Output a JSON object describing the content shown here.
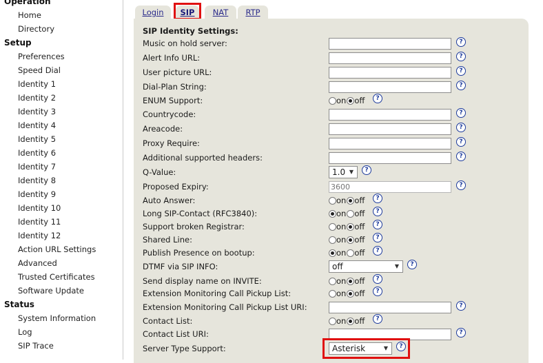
{
  "sidebar": {
    "sections": [
      {
        "title": "Operation",
        "items": [
          "Home",
          "Directory"
        ]
      },
      {
        "title": "Setup",
        "items": [
          "Preferences",
          "Speed Dial",
          "Identity 1",
          "Identity 2",
          "Identity 3",
          "Identity 4",
          "Identity 5",
          "Identity 6",
          "Identity 7",
          "Identity 8",
          "Identity 9",
          "Identity 10",
          "Identity 11",
          "Identity 12",
          "Action URL Settings",
          "Advanced",
          "Trusted Certificates",
          "Software Update"
        ]
      },
      {
        "title": "Status",
        "items": [
          "System Information",
          "Log",
          "SIP Trace"
        ]
      }
    ]
  },
  "tabs": [
    {
      "label": "Login",
      "active": false
    },
    {
      "label": "SIP",
      "active": true
    },
    {
      "label": "NAT",
      "active": false
    },
    {
      "label": "RTP",
      "active": false
    }
  ],
  "section_title": "SIP Identity Settings:",
  "help_glyph": "?",
  "radio_labels": {
    "on": "on",
    "off": "off"
  },
  "fields": [
    {
      "label": "Music on hold server:",
      "type": "text",
      "value": ""
    },
    {
      "label": "Alert Info URL:",
      "type": "text",
      "value": ""
    },
    {
      "label": "User picture URL:",
      "type": "text",
      "value": ""
    },
    {
      "label": "Dial-Plan String:",
      "type": "text",
      "value": ""
    },
    {
      "label": "ENUM Support:",
      "type": "radio",
      "value": "off"
    },
    {
      "label": "Countrycode:",
      "type": "text",
      "value": ""
    },
    {
      "label": "Areacode:",
      "type": "text",
      "value": ""
    },
    {
      "label": "Proxy Require:",
      "type": "text",
      "value": ""
    },
    {
      "label": "Additional supported headers:",
      "type": "text",
      "value": ""
    },
    {
      "label": "Q-Value:",
      "type": "select",
      "value": "1.0"
    },
    {
      "label": "Proposed Expiry:",
      "type": "text",
      "value": "",
      "placeholder": "3600",
      "disabled": true
    },
    {
      "label": "Auto Answer:",
      "type": "radio",
      "value": "off"
    },
    {
      "label": "Long SIP-Contact (RFC3840):",
      "type": "radio",
      "value": "on"
    },
    {
      "label": "Support broken Registrar:",
      "type": "radio",
      "value": "off"
    },
    {
      "label": "Shared Line:",
      "type": "radio",
      "value": "off"
    },
    {
      "label": "Publish Presence on bootup:",
      "type": "radio",
      "value": "on"
    },
    {
      "label": "DTMF via SIP INFO:",
      "type": "select",
      "value": "off"
    },
    {
      "label": "Send display name on INVITE:",
      "type": "radio",
      "value": "off"
    },
    {
      "label": "Extension Monitoring Call Pickup List:",
      "type": "radio",
      "value": "off"
    },
    {
      "label": "Extension Monitoring Call Pickup List URI:",
      "type": "text",
      "value": ""
    },
    {
      "label": "Contact List:",
      "type": "radio",
      "value": "off"
    },
    {
      "label": "Contact List URI:",
      "type": "text",
      "value": ""
    },
    {
      "label": "Server Type Support:",
      "type": "select",
      "value": "Asterisk"
    }
  ],
  "colors": {
    "panel": "#e6e5dc",
    "highlight": "#e01010",
    "help": "#1c3a9c",
    "tab_link": "#2a2a8a"
  }
}
